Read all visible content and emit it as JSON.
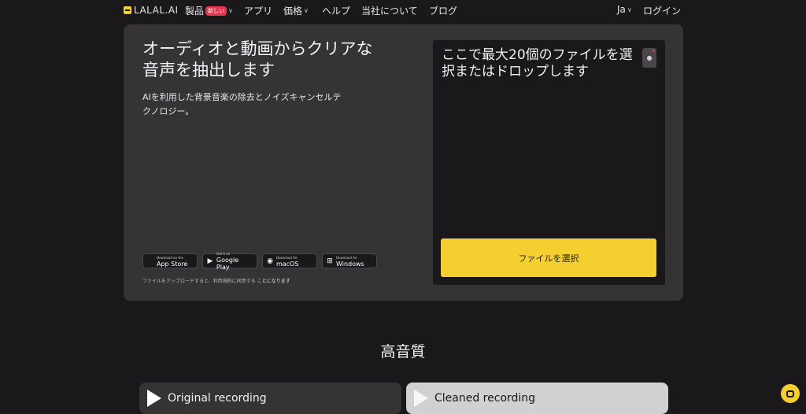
{
  "nav": {
    "logo": "LALAL.AI",
    "products": "製品",
    "products_badge": "新しい",
    "apps": "アプリ",
    "pricing": "価格",
    "help": "ヘルプ",
    "about": "当社について",
    "blog": "ブログ",
    "language": "Ja",
    "login": "ログイン"
  },
  "hero": {
    "title": "オーディオと動画からクリアな音声を抽出します",
    "subtitle": "AIを利用した背景音楽の除去とノイズキャンセルテクノロジー。",
    "stores": [
      {
        "small": "Download on the",
        "big": "App Store",
        "icon": "apple-icon"
      },
      {
        "small": "Get it on",
        "big": "Google Play",
        "icon": "google-play-icon"
      },
      {
        "small": "Download for",
        "big": "macOS",
        "icon": "macos-icon"
      },
      {
        "small": "Download for",
        "big": "Windows",
        "icon": "windows-icon"
      }
    ],
    "terms_prefix": "ファイルをアップロードすると、利用規約に同意する",
    "terms_link": "ことになります"
  },
  "dropzone": {
    "text": "ここで最大20個のファイルを選択またはドロップします",
    "select_button": "ファイルを選択"
  },
  "section": {
    "title": "高音質",
    "original": "Original recording",
    "cleaned": "Cleaned recording"
  },
  "colors": {
    "accent": "#f5cf2f",
    "background": "#1b181b",
    "card": "#363335",
    "badge": "#e5384f"
  }
}
